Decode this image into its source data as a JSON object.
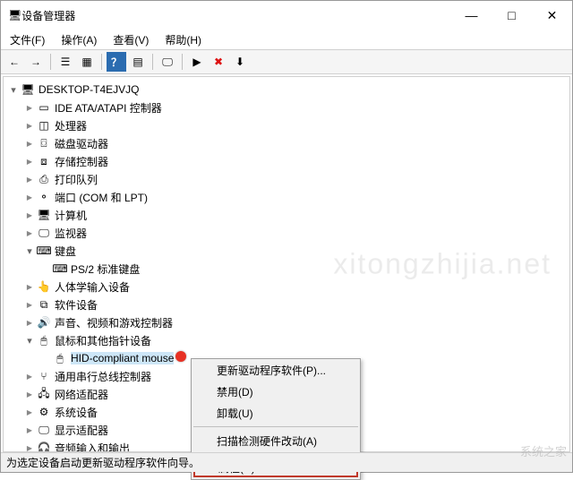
{
  "window": {
    "title": "设备管理器"
  },
  "menubar": [
    {
      "label": "文件(F)"
    },
    {
      "label": "操作(A)"
    },
    {
      "label": "查看(V)"
    },
    {
      "label": "帮助(H)"
    }
  ],
  "toolbar_icons": [
    "back-icon",
    "forward-icon",
    "sep",
    "show-hide-icon",
    "details-icon",
    "sep",
    "help-icon",
    "properties-icon",
    "sep",
    "update-driver-icon",
    "sep",
    "enable-icon",
    "disable-icon",
    "uninstall-icon"
  ],
  "tree": {
    "root": {
      "label": "DESKTOP-T4EJVJQ",
      "expanded": true
    },
    "children": [
      {
        "label": "IDE ATA/ATAPI 控制器",
        "icon": "ide-icon",
        "expanded": false
      },
      {
        "label": "处理器",
        "icon": "cpu-icon",
        "expanded": false
      },
      {
        "label": "磁盘驱动器",
        "icon": "disk-icon",
        "expanded": false
      },
      {
        "label": "存储控制器",
        "icon": "storage-icon",
        "expanded": false
      },
      {
        "label": "打印队列",
        "icon": "printer-icon",
        "expanded": false
      },
      {
        "label": "端口 (COM 和 LPT)",
        "icon": "port-icon",
        "expanded": false
      },
      {
        "label": "计算机",
        "icon": "computer-icon",
        "expanded": false
      },
      {
        "label": "监视器",
        "icon": "monitor-icon",
        "expanded": false
      },
      {
        "label": "键盘",
        "icon": "keyboard-icon",
        "expanded": true,
        "children": [
          {
            "label": "PS/2 标准键盘",
            "icon": "keyboard-icon"
          }
        ]
      },
      {
        "label": "人体学输入设备",
        "icon": "hid-icon",
        "expanded": false
      },
      {
        "label": "软件设备",
        "icon": "software-icon",
        "expanded": false
      },
      {
        "label": "声音、视频和游戏控制器",
        "icon": "audio-icon",
        "expanded": false
      },
      {
        "label": "鼠标和其他指针设备",
        "icon": "mouse-icon",
        "expanded": true,
        "children": [
          {
            "label": "HID-compliant mouse",
            "icon": "mouse-icon",
            "selected": true
          }
        ]
      },
      {
        "label": "通用串行总线控制器",
        "icon": "usb-icon",
        "expanded": false
      },
      {
        "label": "网络适配器",
        "icon": "network-icon",
        "expanded": false
      },
      {
        "label": "系统设备",
        "icon": "system-icon",
        "expanded": false
      },
      {
        "label": "显示适配器",
        "icon": "display-icon",
        "expanded": false
      },
      {
        "label": "音频输入和输出",
        "icon": "audioio-icon",
        "expanded": false
      }
    ]
  },
  "context_menu": {
    "items": [
      {
        "label": "更新驱动程序软件(P)..."
      },
      {
        "label": "禁用(D)"
      },
      {
        "label": "卸载(U)"
      },
      {
        "sep": true
      },
      {
        "label": "扫描检测硬件改动(A)"
      },
      {
        "sep": true
      },
      {
        "label": "属性(R)",
        "highlight": true
      }
    ]
  },
  "statusbar": {
    "text": "为选定设备启动更新驱动程序软件向导。"
  },
  "watermark": {
    "top": "xitongzhijia.net",
    "bottom": "系统之家"
  },
  "icons": {
    "back-icon": "←",
    "forward-icon": "→",
    "show-hide-icon": "☰",
    "details-icon": "▦",
    "help-icon": "？",
    "properties-icon": "▤",
    "update-driver-icon": "🖵",
    "enable-icon": "▶",
    "disable-icon": "✖",
    "uninstall-icon": "⬇",
    "ide-icon": "▭",
    "cpu-icon": "◫",
    "disk-icon": "⌼",
    "storage-icon": "⧈",
    "printer-icon": "⎙",
    "port-icon": "⚬",
    "computer-icon": "🖥",
    "monitor-icon": "🖵",
    "keyboard-icon": "⌨",
    "hid-icon": "👆",
    "software-icon": "⧉",
    "audio-icon": "🔊",
    "mouse-icon": "🖱",
    "usb-icon": "⑂",
    "network-icon": "🖧",
    "system-icon": "⚙",
    "display-icon": "🖵",
    "audioio-icon": "🎧",
    "pc-icon": "🖥"
  },
  "arrows": {
    "collapsed": "▶",
    "expanded": "▾"
  },
  "win_buttons": {
    "min": "—",
    "max": "□",
    "close": "✕"
  }
}
